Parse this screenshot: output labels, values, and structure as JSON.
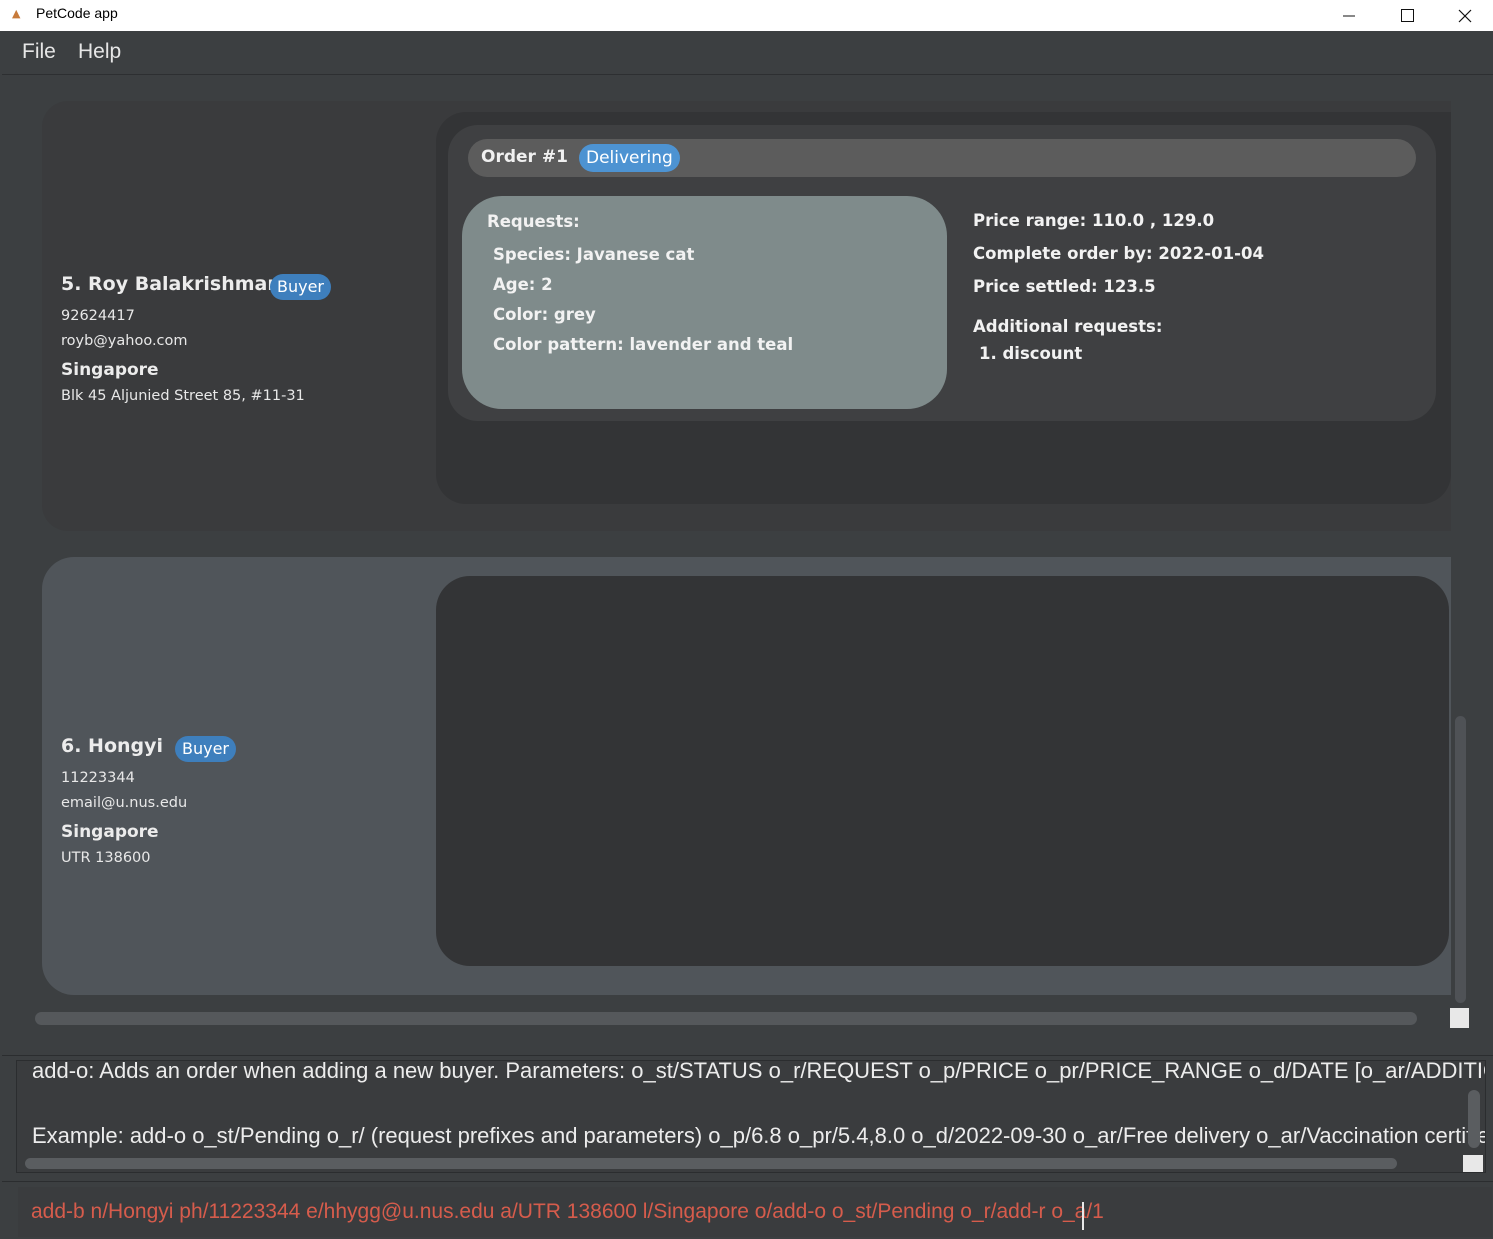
{
  "window": {
    "title": "PetCode app",
    "minimize_glyph": "—",
    "maximize_glyph": "☐",
    "close_glyph": "✕"
  },
  "menu": {
    "file": "File",
    "help": "Help"
  },
  "persons": [
    {
      "name": "5.  Roy Balakrishman",
      "role": "Buyer",
      "phone": "92624417",
      "email": "royb@yahoo.com",
      "location": "Singapore",
      "address": "Blk 45 Aljunied Street 85, #11-31",
      "orders": [
        {
          "title": "Order #1",
          "status": "Delivering",
          "requests_heading": "Requests:",
          "requests": [
            "Species: Javanese cat",
            "Age: 2",
            "Color: grey",
            "Color pattern: lavender and teal"
          ],
          "price_range": "Price range: 110.0 , 129.0",
          "complete_by": "Complete order by: 2022-01-04",
          "price_settled": "Price settled: 123.5",
          "additional_heading": "Additional requests:",
          "additional": [
            "1. discount"
          ]
        }
      ]
    },
    {
      "name": "6.  Hongyi",
      "role": "Buyer",
      "phone": "11223344",
      "email": "email@u.nus.edu",
      "location": "Singapore",
      "address": "UTR 138600",
      "orders": []
    }
  ],
  "result": {
    "line1": "add-o: Adds an order when adding a new buyer. Parameters: o_st/STATUS o_r/REQUEST o_p/PRICE o_pr/PRICE_RANGE o_d/DATE [o_ar/ADDITIONAL_REQUEST]",
    "line2": "Example: add-o o_st/Pending o_r/ (request prefixes and parameters) o_p/6.8 o_pr/5.4,8.0 o_d/2022-09-30 o_ar/Free delivery o_ar/Vaccination certified"
  },
  "command": {
    "value": "add-b n/Hongyi ph/11223344 e/hhygg@u.nus.edu a/UTR 138600 l/Singapore o/add-o o_st/Pending o_r/add-r o_a/1"
  },
  "colors": {
    "badge": "#3e7fbd",
    "status": "#4d93d2",
    "command_error_text": "#d65c4c"
  }
}
